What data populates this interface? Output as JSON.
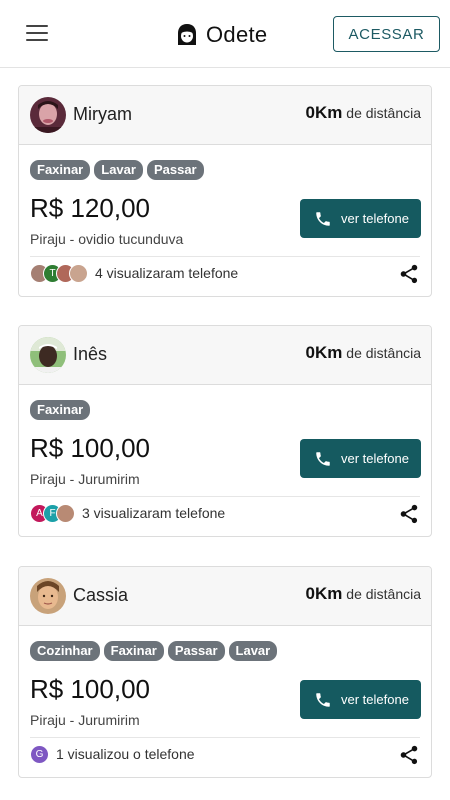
{
  "header": {
    "app_name": "Odete",
    "login_label": "ACESSAR",
    "menu_icon": "hamburger-menu-icon",
    "logo_icon": "maid-face-icon"
  },
  "colors": {
    "primary": "#155a60",
    "tag": "#6c737a",
    "card_header_bg": "#f7f7f7"
  },
  "listings": [
    {
      "name": "Miryam",
      "distance_value": "0Km",
      "distance_label": "de distância",
      "tags": [
        "Faxinar",
        "Lavar",
        "Passar"
      ],
      "price": "R$ 120,00",
      "location": "Piraju - ovidio tucunduva",
      "phone_label": "ver telefone",
      "viewers": [
        {
          "initial": "",
          "color": "#a57f73"
        },
        {
          "initial": "T",
          "color": "#2e7d32"
        },
        {
          "initial": "",
          "color": "#b0685a"
        },
        {
          "initial": "",
          "color": "#c9a48f"
        }
      ],
      "viewers_text": "4 visualizaram telefone"
    },
    {
      "name": "Inês",
      "distance_value": "0Km",
      "distance_label": "de distância",
      "tags": [
        "Faxinar"
      ],
      "price": "R$ 100,00",
      "location": "Piraju - Jurumirim",
      "phone_label": "ver telefone",
      "viewers": [
        {
          "initial": "A",
          "color": "#c2185b"
        },
        {
          "initial": "F",
          "color": "#1ba0a8"
        },
        {
          "initial": "",
          "color": "#b88a74"
        }
      ],
      "viewers_text": "3 visualizaram telefone"
    },
    {
      "name": "Cassia",
      "distance_value": "0Km",
      "distance_label": "de distância",
      "tags": [
        "Cozinhar",
        "Faxinar",
        "Passar",
        "Lavar"
      ],
      "price": "R$ 100,00",
      "location": "Piraju - Jurumirim",
      "phone_label": "ver telefone",
      "viewers": [
        {
          "initial": "G",
          "color": "#7e57c2"
        }
      ],
      "viewers_text": "1 visualizou o telefone"
    }
  ]
}
